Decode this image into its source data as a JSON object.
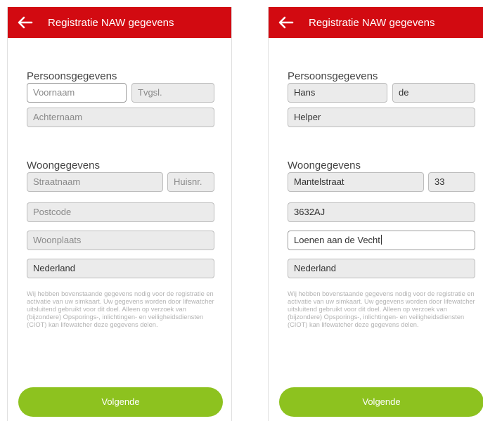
{
  "screens": [
    {
      "title": "Registratie NAW gegevens",
      "persoonsgegevens_label": "Persoonsgegevens",
      "voornaam": "Voornaam",
      "tussenvoegsel": "Tvgsl.",
      "achternaam": "Achternaam",
      "woongegevens_label": "Woongegevens",
      "straatnaam": "Straatnaam",
      "huisnummer": "Huisnr.",
      "postcode": "Postcode",
      "woonplaats": "Woonplaats",
      "land": "Nederland",
      "disclaimer": "Wij hebben bovenstaande gegevens nodig voor de registratie en activatie van uw simkaart. Uw gegevens worden door lifewatcher uitsluitend gebruikt voor dit doel. Alleen op verzoek van (bijzondere) Opsporings-, inlichtingen- en veiligheidsdiensten (CIOT) kan lifewatcher deze gegevens delen.",
      "next_label": "Volgende"
    },
    {
      "title": "Registratie NAW gegevens",
      "persoonsgegevens_label": "Persoonsgegevens",
      "voornaam": "Hans",
      "tussenvoegsel": "de",
      "achternaam": "Helper",
      "woongegevens_label": "Woongegevens",
      "straatnaam": "Mantelstraat",
      "huisnummer": "33",
      "postcode": "3632AJ",
      "woonplaats": "Loenen aan de Vecht",
      "land": "Nederland",
      "disclaimer": "Wij hebben bovenstaande gegevens nodig voor de registratie en activatie van uw simkaart. Uw gegevens worden door lifewatcher uitsluitend gebruikt voor dit doel. Alleen op verzoek van (bijzondere) Opsporings-, inlichtingen- en veiligheidsdiensten (CIOT) kan lifewatcher deze gegevens delen.",
      "next_label": "Volgende"
    }
  ],
  "colors": {
    "app_bar": "#d20a11",
    "button": "#8dc21f",
    "field_bg": "#ebebeb"
  },
  "icons": {
    "back": "arrow-left"
  }
}
